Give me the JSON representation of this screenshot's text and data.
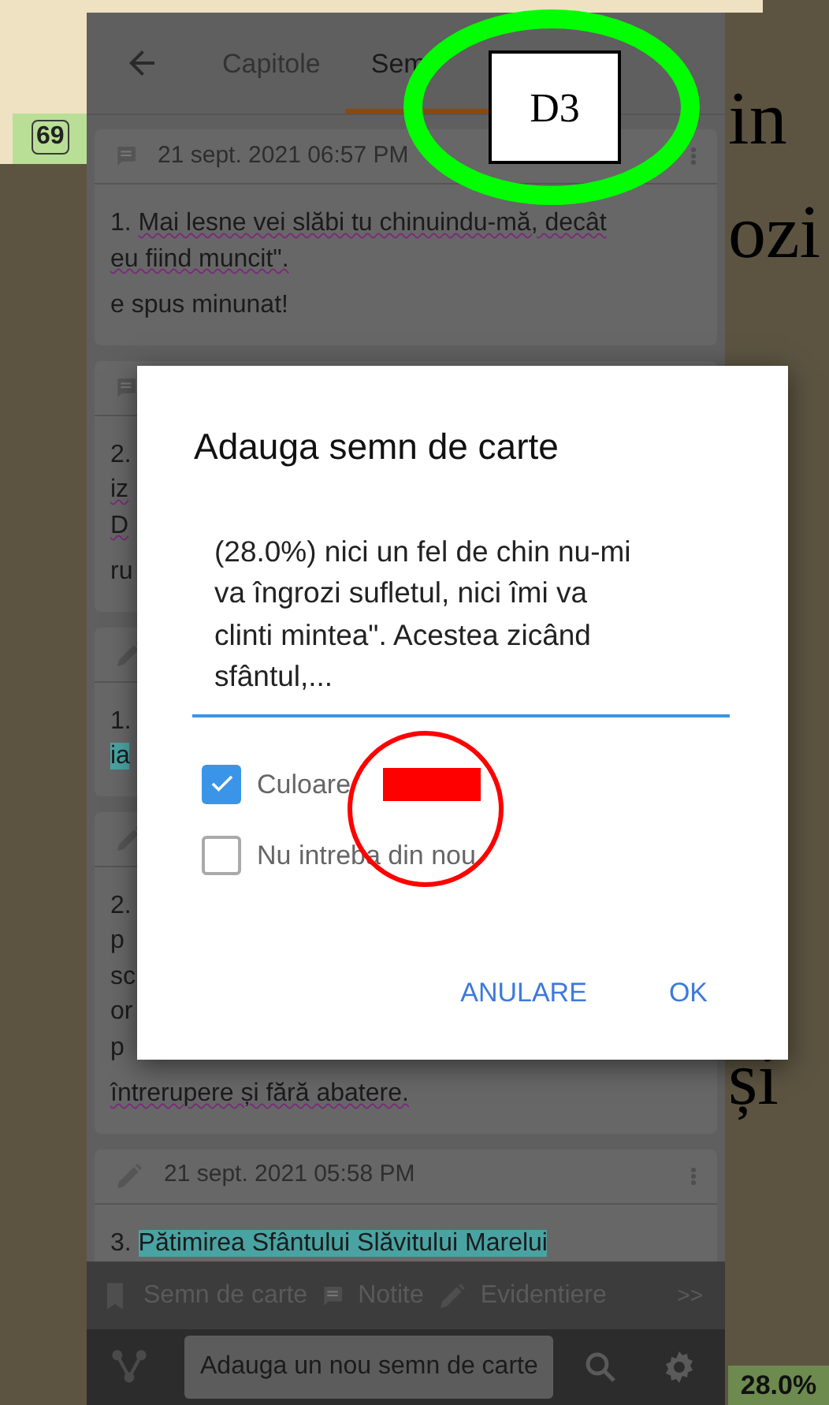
{
  "top_fragment": {
    "badge": "69"
  },
  "page_words": [
    "in",
    "ozi",
    "și"
  ],
  "page_progress": "28.0%",
  "header": {
    "tabs": [
      {
        "label": "Capitole",
        "selected": false
      },
      {
        "label": "Sem",
        "selected": true
      }
    ]
  },
  "cards": [
    {
      "kind": "note",
      "date": "21 sept. 2021 06:57 PM",
      "menu": true,
      "paragraphs": [
        [
          [
            {
              "text": "1. ",
              "highlighted": false,
              "underlined": false
            },
            {
              "text": "Mai lesne vei slăbi tu chinuindu-mă, decât",
              "highlighted": false,
              "underlined": true
            }
          ],
          [
            {
              "text": "eu fiind muncit\".",
              "highlighted": false,
              "underlined": true
            }
          ]
        ],
        [
          [
            {
              "text": "e spus minunat!",
              "highlighted": false,
              "underlined": false
            }
          ]
        ]
      ]
    },
    {
      "kind": "note",
      "menu": false,
      "paragraphs": [
        [
          [
            {
              "text": "2.",
              "highlighted": false,
              "underlined": false
            }
          ],
          [
            {
              "text": "iz",
              "highlighted": false,
              "underlined": true
            }
          ],
          [
            {
              "text": "D",
              "highlighted": false,
              "underlined": true
            }
          ]
        ],
        [
          [
            {
              "text": "ru",
              "highlighted": false,
              "underlined": false
            }
          ]
        ]
      ]
    },
    {
      "kind": "highlight",
      "menu": false,
      "paragraphs": [
        [
          [
            {
              "text": "1.",
              "highlighted": false,
              "underlined": false
            }
          ],
          [
            {
              "text": "ia",
              "highlighted": true,
              "underlined": false
            }
          ]
        ]
      ]
    },
    {
      "kind": "highlight",
      "menu": false,
      "paragraphs": [
        [
          [
            {
              "text": "2.",
              "highlighted": false,
              "underlined": false
            }
          ],
          [
            {
              "text": "p",
              "highlighted": false,
              "underlined": false
            }
          ],
          [
            {
              "text": "sc",
              "highlighted": false,
              "underlined": false
            }
          ],
          [
            {
              "text": "or",
              "highlighted": false,
              "underlined": false
            }
          ],
          [
            {
              "text": "p",
              "highlighted": false,
              "underlined": false
            }
          ]
        ],
        [
          [
            {
              "text": "întrerupere și fără abatere.",
              "highlighted": false,
              "underlined": true
            }
          ]
        ]
      ]
    },
    {
      "kind": "highlight",
      "date": "21 sept. 2021 05:58 PM",
      "menu": true,
      "paragraphs": [
        [
          [
            {
              "text": "3. ",
              "highlighted": false,
              "underlined": false
            },
            {
              "text": "Pătimirea Sfântului Slăvitului Marelui",
              "highlighted": true,
              "underlined": false
            }
          ]
        ]
      ]
    }
  ],
  "toolbar": {
    "items": [
      {
        "kind": "bookmark",
        "label": "Semn de carte"
      },
      {
        "kind": "note",
        "label": "Notite"
      },
      {
        "kind": "pencil",
        "label": "Evidentiere"
      }
    ],
    "more": ">>"
  },
  "bottom_bar": {
    "add_button": "Adauga un nou semn de carte"
  },
  "dialog": {
    "title": "Adauga semn de carte",
    "value": "(28.0%) nici un fel de chin nu-mi\nva îngrozi sufletul, nici îmi va\nclinti mintea\". Acestea zicând\nsfântul,...",
    "options": [
      {
        "label": "Culoare",
        "checked": true,
        "color": "#ff0000"
      },
      {
        "label": "Nu intreba din nou",
        "checked": false
      }
    ],
    "buttons": [
      "ANULARE",
      "OK"
    ]
  },
  "annotations": [
    {
      "kind": "ellipse",
      "color": "#00ff00"
    },
    {
      "kind": "label",
      "text": "D3"
    },
    {
      "kind": "circle",
      "color": "#ff0000"
    }
  ]
}
